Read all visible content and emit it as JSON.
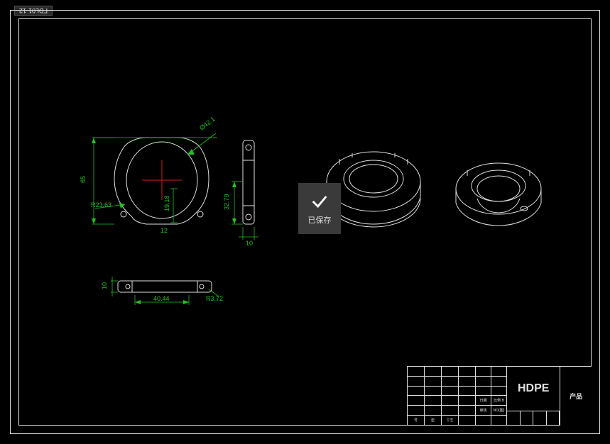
{
  "tab": "FDL01-12",
  "toast": {
    "label": "已保存"
  },
  "dimensions": {
    "height_65": "65",
    "radius_23_63": "R23.63",
    "diameter_42_1": "Ø42.1",
    "height_19_18": "19.18",
    "height_32_79": "32.79",
    "width_10_side": "10",
    "height_10_bottom": "10",
    "width_40_44": "40.44",
    "radius_3_72": "R3.72",
    "dim_12": "12"
  },
  "title_block": {
    "material": "HDPE",
    "product_label": "产品",
    "cells": {
      "r4c5": "日期",
      "r4c6": "比例 B",
      "r5c5": "审核",
      "r5c6": "NO(图)",
      "r6c1": "号",
      "r6c2": "型",
      "r6c3": "工艺"
    }
  }
}
